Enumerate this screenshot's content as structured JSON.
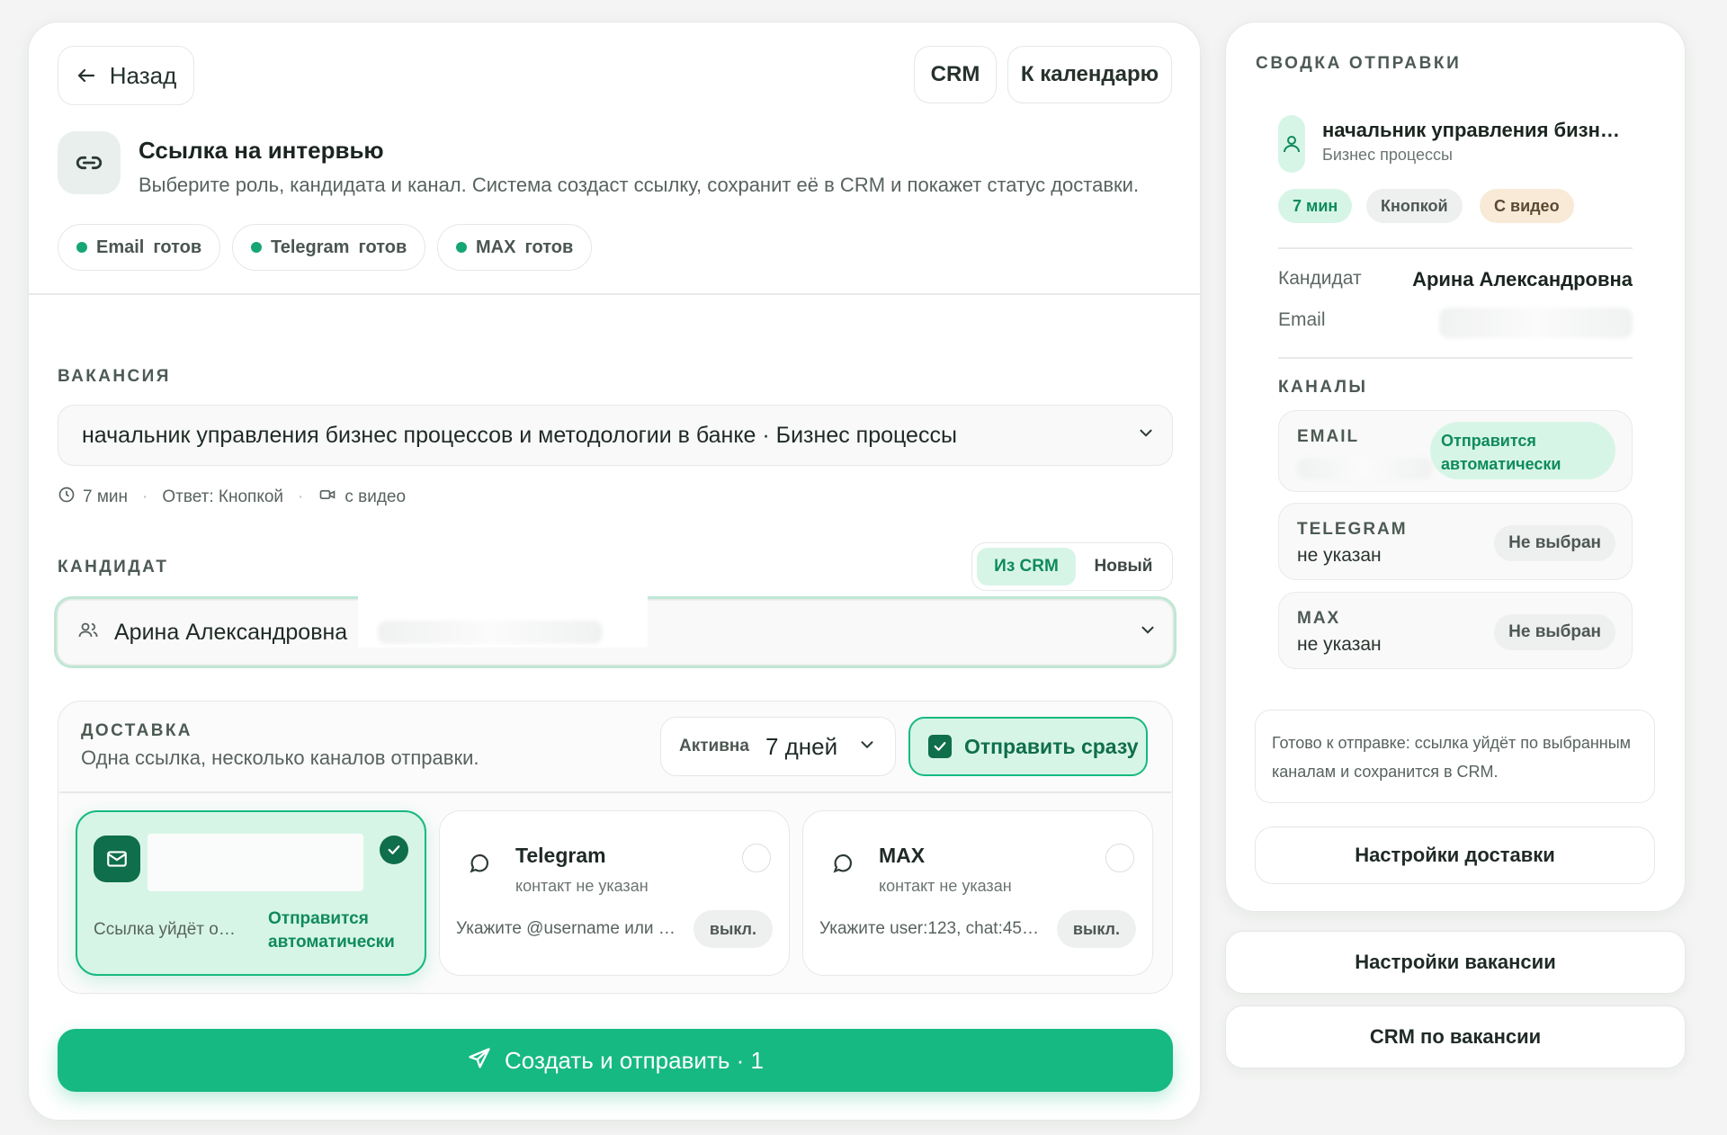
{
  "header": {
    "back_label": "Назад",
    "crm_label": "CRM",
    "calendar_label": "К календарю"
  },
  "intro": {
    "title": "Ссылка на интервью",
    "description": "Выберите роль, кандидата и канал. Система создаст ссылку, сохранит её в CRM и покажет статус доставки."
  },
  "status_pills": [
    {
      "channel": "Email",
      "state": "готов"
    },
    {
      "channel": "Telegram",
      "state": "готов"
    },
    {
      "channel": "MAX",
      "state": "готов"
    }
  ],
  "vacancy": {
    "label": "ВАКАНСИЯ",
    "selected": "начальник управления бизнес процессов и методологии в банке · Бизнес процессы",
    "duration": "7 мин",
    "answer": "Ответ: Кнопкой",
    "video": "с видео"
  },
  "candidate": {
    "label": "КАНДИДАТ",
    "source_options": [
      "Из CRM",
      "Новый"
    ],
    "source_active": "Из CRM",
    "selected": "Арина Александровна"
  },
  "delivery": {
    "label": "ДОСТАВКА",
    "subtitle": "Одна ссылка, несколько каналов отправки.",
    "active_label": "Активна",
    "active_value": "7 дней",
    "send_now_label": "Отправить сразу",
    "send_now_checked": true,
    "channels": {
      "email": {
        "hint": "Ссылка уйдёт о…",
        "status": "Отправится автоматически",
        "selected": true
      },
      "telegram": {
        "title": "Telegram",
        "subtitle": "контакт не указан",
        "hint": "Укажите @username или …",
        "toggle": "выкл."
      },
      "max": {
        "title": "MAX",
        "subtitle": "контакт не указан",
        "hint": "Укажите user:123, chat:45…",
        "toggle": "выкл."
      }
    }
  },
  "submit": {
    "label": "Создать и отправить · 1"
  },
  "summary": {
    "title": "СВОДКА ОТПРАВКИ",
    "role": "начальник управления бизн…",
    "department": "Бизнес процессы",
    "chips": [
      "7 мин",
      "Кнопкой",
      "С видео"
    ],
    "candidate_label": "Кандидат",
    "candidate_value": "Арина Александровна",
    "email_label": "Email",
    "channels_title": "КАНАЛЫ",
    "channels": [
      {
        "name": "EMAIL",
        "value": "",
        "status": "Отправится автоматически"
      },
      {
        "name": "TELEGRAM",
        "value": "не указан",
        "status": "Не выбран"
      },
      {
        "name": "MAX",
        "value": "не указан",
        "status": "Не выбран"
      }
    ],
    "ready_text": "Готово к отправке: ссылка уйдёт по выбранным каналам и сохранится в CRM.",
    "delivery_settings_label": "Настройки доставки"
  },
  "side_actions": {
    "vacancy_settings": "Настройки вакансии",
    "vacancy_crm": "CRM по вакансии"
  },
  "colors": {
    "accent": "#16b981",
    "accent_soft": "#d7f5e7",
    "accent_text": "#0f8a5f",
    "warm_chip": "#f8ead6"
  }
}
